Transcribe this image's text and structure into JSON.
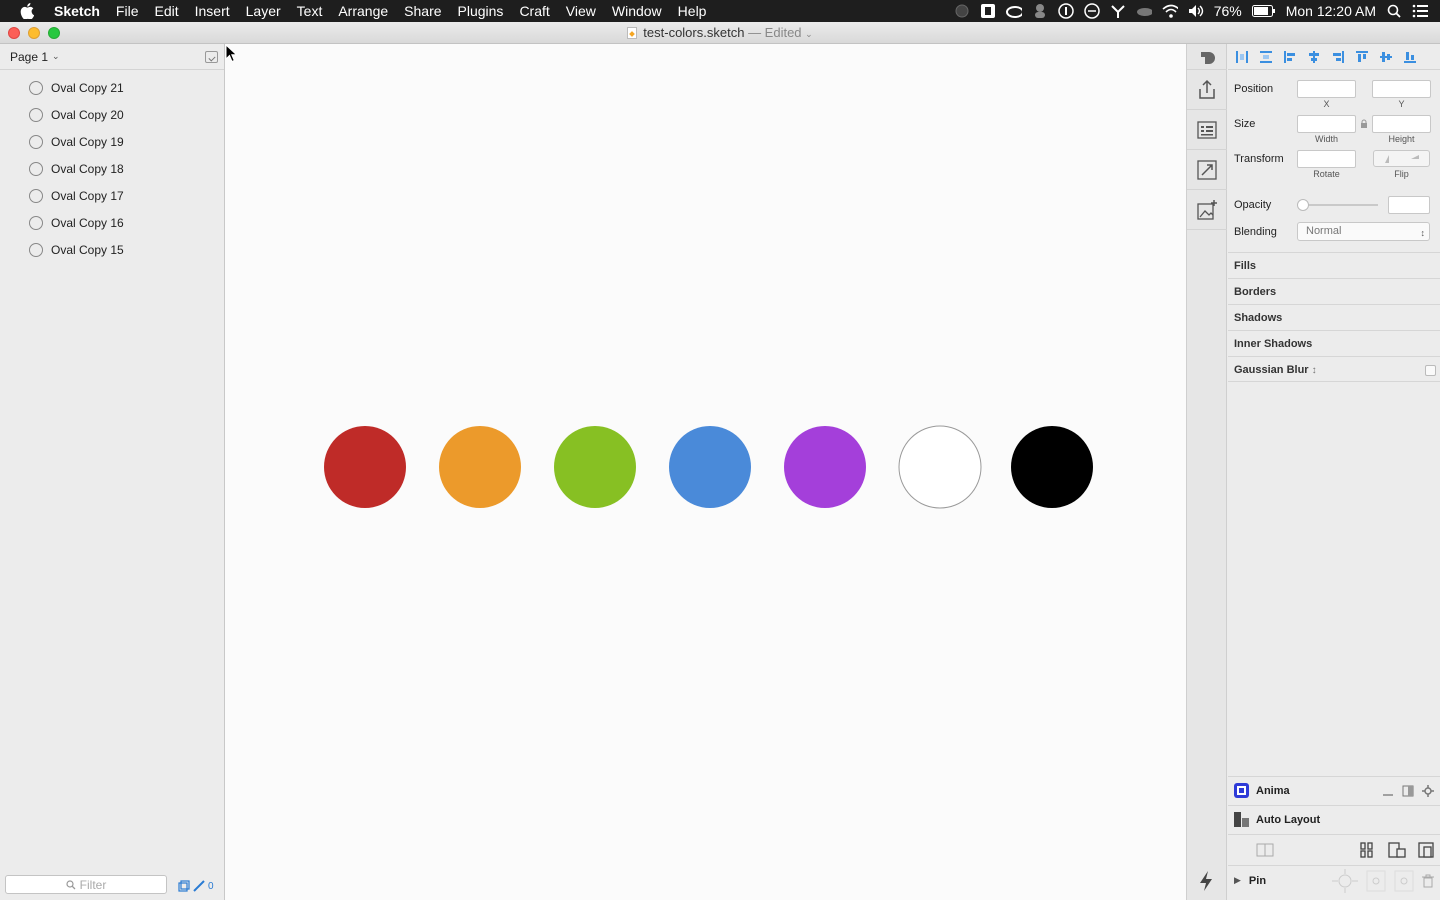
{
  "menubar": {
    "app": "Sketch",
    "items": [
      "File",
      "Edit",
      "Insert",
      "Layer",
      "Text",
      "Arrange",
      "Share",
      "Plugins",
      "Craft",
      "View",
      "Window",
      "Help"
    ],
    "battery": "76%",
    "clock": "Mon 12:20 AM"
  },
  "window": {
    "filename": "test-colors.sketch",
    "edited": "— Edited"
  },
  "layers": {
    "page_label": "Page 1",
    "items": [
      "Oval Copy 21",
      "Oval Copy 20",
      "Oval Copy 19",
      "Oval Copy 18",
      "Oval Copy 17",
      "Oval Copy 16",
      "Oval Copy 15"
    ],
    "filter_placeholder": "Filter",
    "filter_count": "0"
  },
  "canvas": {
    "circles": [
      {
        "fill": "#bf2b28",
        "stroke": "none"
      },
      {
        "fill": "#ec9a2b",
        "stroke": "none"
      },
      {
        "fill": "#87c023",
        "stroke": "none"
      },
      {
        "fill": "#4a8ad9",
        "stroke": "none"
      },
      {
        "fill": "#a43fda",
        "stroke": "none"
      },
      {
        "fill": "#ffffff",
        "stroke": "#9a9a9a"
      },
      {
        "fill": "#000000",
        "stroke": "none"
      }
    ]
  },
  "inspector": {
    "position_label": "Position",
    "x_label": "X",
    "y_label": "Y",
    "size_label": "Size",
    "width_label": "Width",
    "height_label": "Height",
    "transform_label": "Transform",
    "rotate_label": "Rotate",
    "flip_label": "Flip",
    "opacity_label": "Opacity",
    "blending_label": "Blending",
    "blending_value": "Normal",
    "sections": [
      "Fills",
      "Borders",
      "Shadows",
      "Inner Shadows",
      "Gaussian Blur"
    ]
  },
  "plugins": {
    "anima": "Anima",
    "auto_layout": "Auto Layout",
    "pin": "Pin"
  }
}
